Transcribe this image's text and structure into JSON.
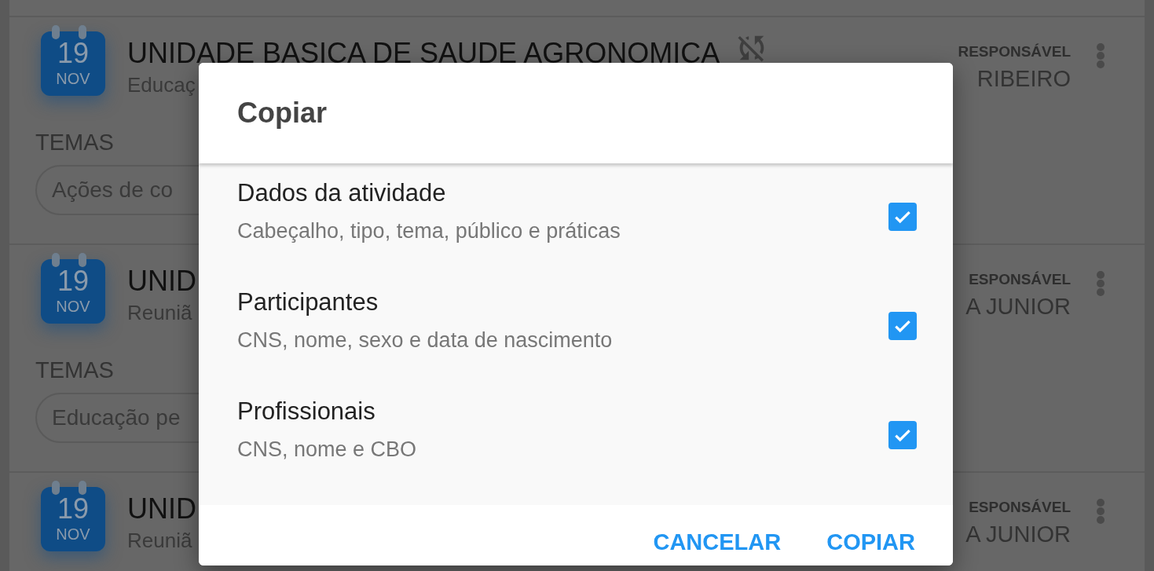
{
  "cards": [
    {
      "day": "19",
      "month": "NOV",
      "title": "UNIDADE BASICA DE SAUDE AGRONOMICA",
      "subtitle": "Educaç",
      "sync_off": true,
      "responsible_label": "RESPONSÁVEL",
      "responsible": "RIBEIRO",
      "themes_label": "TEMAS",
      "theme_chip": "Ações de co"
    },
    {
      "day": "19",
      "month": "NOV",
      "title": "UNID",
      "subtitle": "Reuniã",
      "responsible_label": "ESPONSÁVEL",
      "responsible": "A JUNIOR",
      "themes_label": "TEMAS",
      "theme_chip": "Educação pe"
    },
    {
      "day": "19",
      "month": "NOV",
      "title": "UNID",
      "subtitle": "Reuniã",
      "responsible_label": "ESPONSÁVEL",
      "responsible": "A JUNIOR"
    }
  ],
  "dialog": {
    "title": "Copiar",
    "options": [
      {
        "label": "Dados da atividade",
        "description": "Cabeçalho, tipo, tema, público e práticas",
        "checked": true
      },
      {
        "label": "Participantes",
        "description": "CNS, nome, sexo e data de nascimento",
        "checked": true
      },
      {
        "label": "Profissionais",
        "description": "CNS, nome e CBO",
        "checked": true
      }
    ],
    "buttons": [
      {
        "label": "CANCELAR"
      },
      {
        "label": "COPIAR"
      }
    ]
  }
}
